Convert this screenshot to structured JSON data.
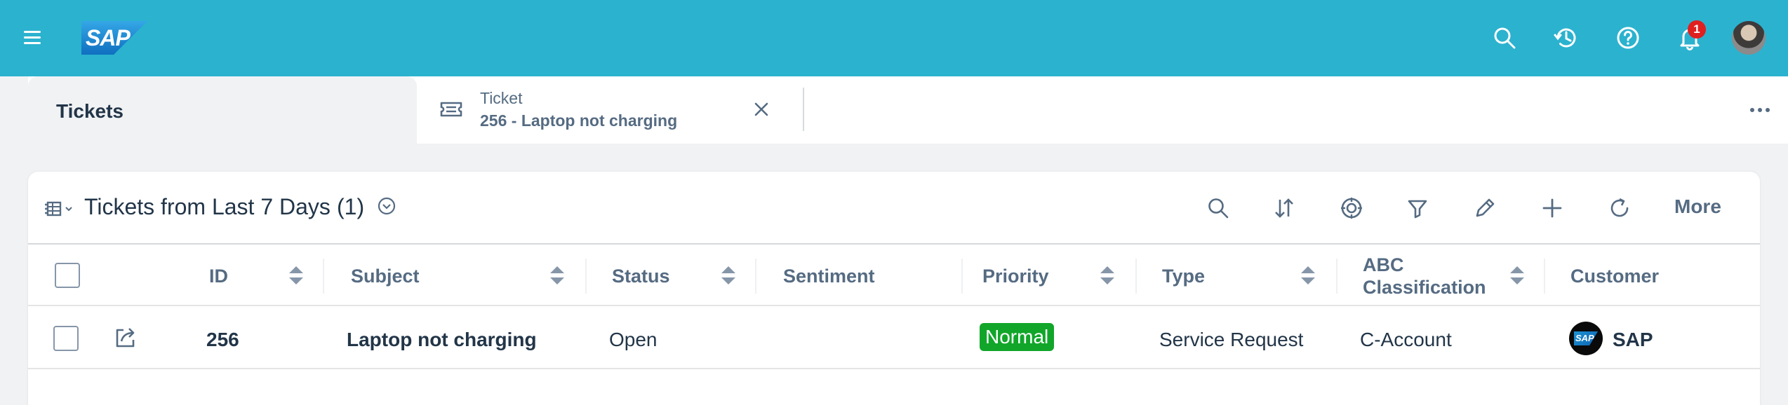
{
  "shell": {
    "logo_text": "SAP",
    "notification_count": "1",
    "icons": [
      "menu-icon",
      "search-icon",
      "history-icon",
      "help-icon",
      "bell-icon",
      "avatar"
    ],
    "accent_color": "#2bb2cf"
  },
  "tabs": {
    "home_label": "Tickets",
    "ticket_kicker": "Ticket",
    "ticket_title": "256 - Laptop not charging"
  },
  "list": {
    "title": "Tickets from Last 7 Days",
    "count": "(1)",
    "more_label": "More",
    "toolbar_icons": [
      "search-icon",
      "sort-icon",
      "target-icon",
      "filter-icon",
      "edit-icon",
      "add-icon",
      "refresh-icon"
    ]
  },
  "table": {
    "columns": {
      "id": "ID",
      "subject": "Subject",
      "status": "Status",
      "sentiment": "Sentiment",
      "priority": "Priority",
      "type": "Type",
      "abc_line1": "ABC",
      "abc_line2": "Classification",
      "customer": "Customer"
    },
    "rows": [
      {
        "id": "256",
        "subject": "Laptop not charging",
        "status": "Open",
        "sentiment": "",
        "priority": "Normal",
        "type": "Service Request",
        "abc": "C-Account",
        "customer": "SAP",
        "customer_logo_text": "SAP"
      }
    ]
  },
  "colors": {
    "priority_normal": "#11a62a",
    "badge": "#e01f1f"
  }
}
